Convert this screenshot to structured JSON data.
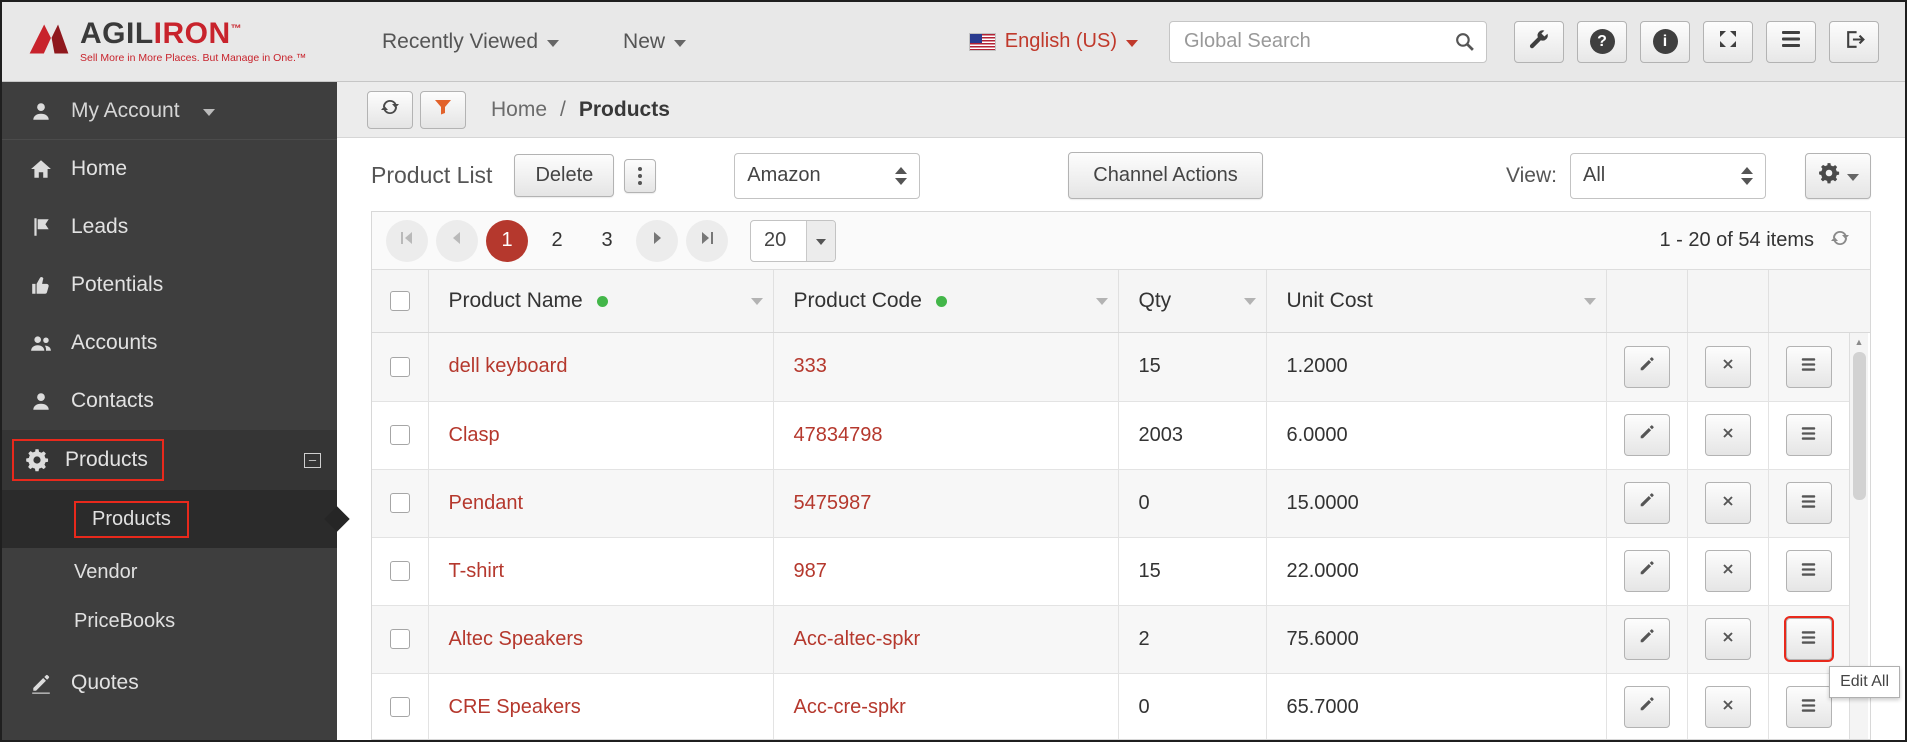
{
  "app": {
    "logo_primary": "AGIL",
    "logo_secondary": "IRON",
    "logo_tm": "™",
    "tagline": "Sell More in More Places. But Manage in One.™"
  },
  "header": {
    "recently_viewed": "Recently Viewed",
    "new_menu": "New",
    "language": "English (US)",
    "search_placeholder": "Global Search",
    "icons": [
      "wrench-icon",
      "help-icon",
      "info-icon",
      "expand-icon",
      "menu-icon",
      "logout-icon"
    ],
    "help_glyph": "?",
    "info_glyph": "i"
  },
  "sidebar": {
    "my_account": "My Account",
    "items": [
      {
        "label": "Home",
        "icon": "home-icon"
      },
      {
        "label": "Leads",
        "icon": "flag-icon"
      },
      {
        "label": "Potentials",
        "icon": "thumbs-up-icon"
      },
      {
        "label": "Accounts",
        "icon": "users-icon"
      },
      {
        "label": "Contacts",
        "icon": "user-icon"
      },
      {
        "label": "Products",
        "icon": "gears-icon"
      }
    ],
    "sub_items": [
      {
        "label": "Products"
      },
      {
        "label": "Vendor"
      },
      {
        "label": "PriceBooks"
      }
    ],
    "quotes": "Quotes"
  },
  "breadcrumb": {
    "home": "Home",
    "separator": "/",
    "current": "Products"
  },
  "toolbar": {
    "title": "Product List",
    "delete_label": "Delete",
    "channel_value": "Amazon",
    "channel_actions_label": "Channel Actions",
    "view_label": "View:",
    "view_value": "All"
  },
  "pagination": {
    "page1": "1",
    "page2": "2",
    "page3": "3",
    "active_page": "1",
    "page_size": "20",
    "items_info": "1 - 20 of 54 items"
  },
  "table": {
    "headers": {
      "name": "Product Name",
      "code": "Product Code",
      "qty": "Qty",
      "cost": "Unit Cost"
    },
    "rows": [
      {
        "name": "dell keyboard",
        "code": "333",
        "qty": "15",
        "cost": "1.2000"
      },
      {
        "name": "Clasp",
        "code": "47834798",
        "qty": "2003",
        "cost": "6.0000"
      },
      {
        "name": "Pendant",
        "code": "5475987",
        "qty": "0",
        "cost": "15.0000"
      },
      {
        "name": "T-shirt",
        "code": "987",
        "qty": "15",
        "cost": "22.0000"
      },
      {
        "name": "Altec Speakers",
        "code": "Acc-altec-spkr",
        "qty": "2",
        "cost": "75.6000"
      },
      {
        "name": "CRE Speakers",
        "code": "Acc-cre-spkr",
        "qty": "0",
        "cost": "65.7000"
      }
    ]
  },
  "tooltip": {
    "edit_all": "Edit All"
  },
  "colors": {
    "link_red": "#b5382d",
    "annotation_red": "#e8291c",
    "green_dot": "#43b649",
    "funnel_orange": "#e2622b",
    "sidebar_bg": "#3e3e3e"
  }
}
